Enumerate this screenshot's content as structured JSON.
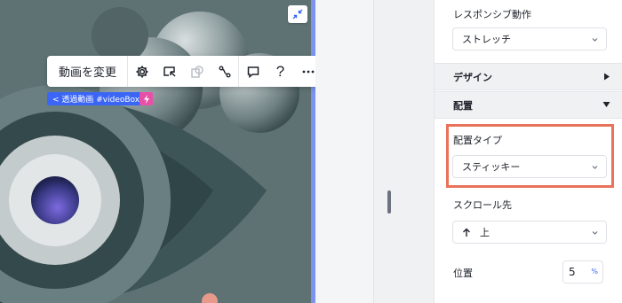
{
  "canvas": {
    "toolbar": {
      "change_video_label": "動画を変更",
      "help_label": "?"
    },
    "breadcrumb_label": "< 透過動画 #videoBox3"
  },
  "panel": {
    "responsive_label": "レスポンシブ動作",
    "responsive_value": "ストレッチ",
    "design_section": "デザイン",
    "placement_section": "配置",
    "placement_type_label": "配置タイプ",
    "placement_type_value": "スティッキー",
    "scroll_target_label": "スクロール先",
    "scroll_target_value": "上",
    "position_label": "位置",
    "position_value": "5",
    "position_unit": "%"
  },
  "colors": {
    "canvas_bg": "#5e7274",
    "accent_blue": "#3b66f5",
    "badge_pink": "#e850a8",
    "highlight_orange": "#e8735a"
  },
  "icons": [
    "collapse-icon",
    "gear-icon",
    "video-edit-icon",
    "duplicate-icon",
    "animation-icon",
    "comment-icon",
    "help-icon",
    "more-icon",
    "bolt-icon",
    "chevron-down-icon",
    "triangle-right-icon",
    "triangle-down-icon",
    "arrow-up-icon"
  ]
}
